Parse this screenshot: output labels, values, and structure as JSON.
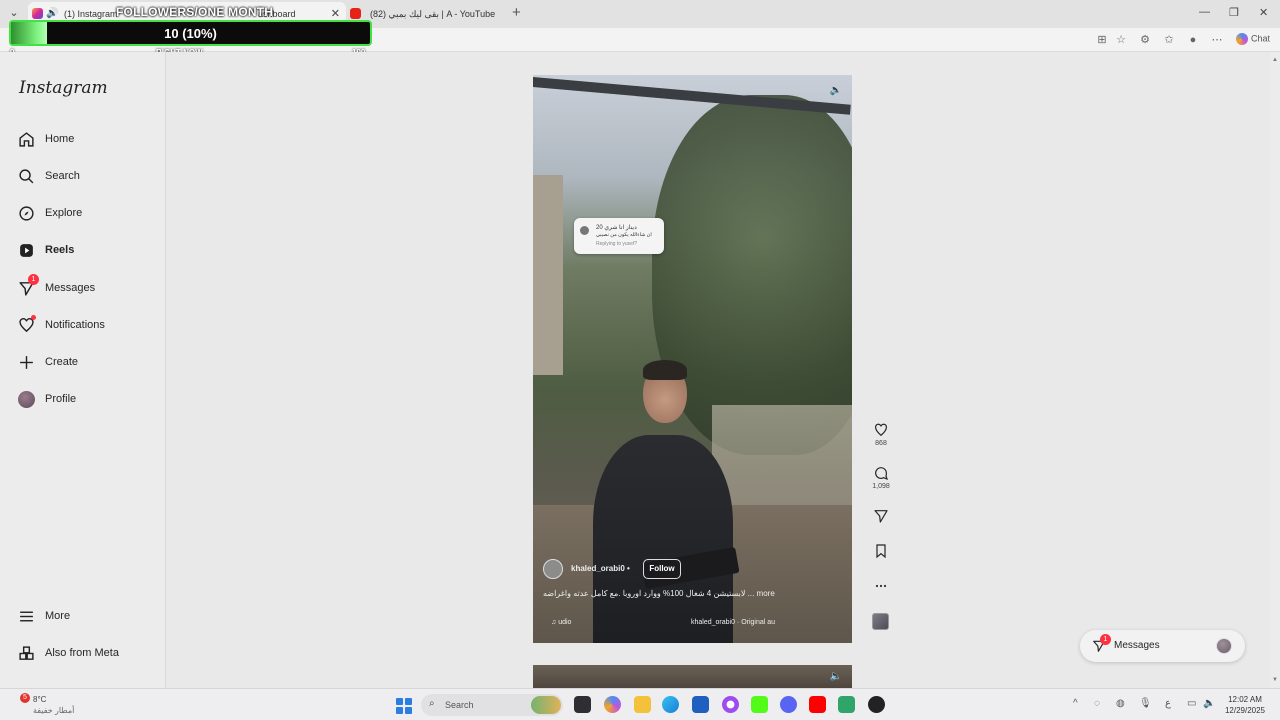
{
  "browser": {
    "tabs": [
      {
        "label": "(1) Instagram",
        "active": true
      },
      {
        "label": "ashboard",
        "active": false
      },
      {
        "label": "(82) بقى ليك بمبي | A - YouTube",
        "active": false
      }
    ],
    "chat_label": "Chat"
  },
  "overlay": {
    "title": "FOLLOWERS/ONE MONTH",
    "value": "10 (10%)",
    "progress_fraction": 0.1,
    "min_label": "0",
    "mid_label": "RIGHT NOW",
    "max_label": "100",
    "accent": "#43e243"
  },
  "sidebar": {
    "logo": "Instagram",
    "items": [
      {
        "label": "Home",
        "icon": "home-icon"
      },
      {
        "label": "Search",
        "icon": "search-icon"
      },
      {
        "label": "Explore",
        "icon": "compass-icon"
      },
      {
        "label": "Reels",
        "icon": "reels-icon",
        "active": true
      },
      {
        "label": "Messages",
        "icon": "messenger-icon",
        "badge": "1"
      },
      {
        "label": "Notifications",
        "icon": "heart-icon"
      },
      {
        "label": "Create",
        "icon": "plus-icon"
      },
      {
        "label": "Profile",
        "icon": "avatar"
      }
    ],
    "more": "More",
    "meta": "Also from Meta"
  },
  "reel": {
    "comment_line1": "20 دينار انا شري",
    "comment_line2": "ان شاءالله يكون من نصيبي",
    "comment_line3": "Replying to yusef?",
    "author": "khaled_orabi0 •",
    "follow_label": "Follow",
    "caption": "لابستيشن 4 شغال 100% ووارد اوروبا .مع كامل عدته واغراضه ... more",
    "audio": "♫ udio",
    "audio_owner": "khaled_orabi0 · Original au"
  },
  "actions": {
    "likes": "868",
    "comments": "1,098"
  },
  "messages_pill": {
    "label": "Messages",
    "badge": "1"
  },
  "taskbar": {
    "weather_badge": "5",
    "temperature": "8°C",
    "weather_desc": "أمطار خفيفة",
    "search_placeholder": "Search",
    "time": "12:02 AM",
    "date": "12/29/2025",
    "lang": "ع"
  }
}
